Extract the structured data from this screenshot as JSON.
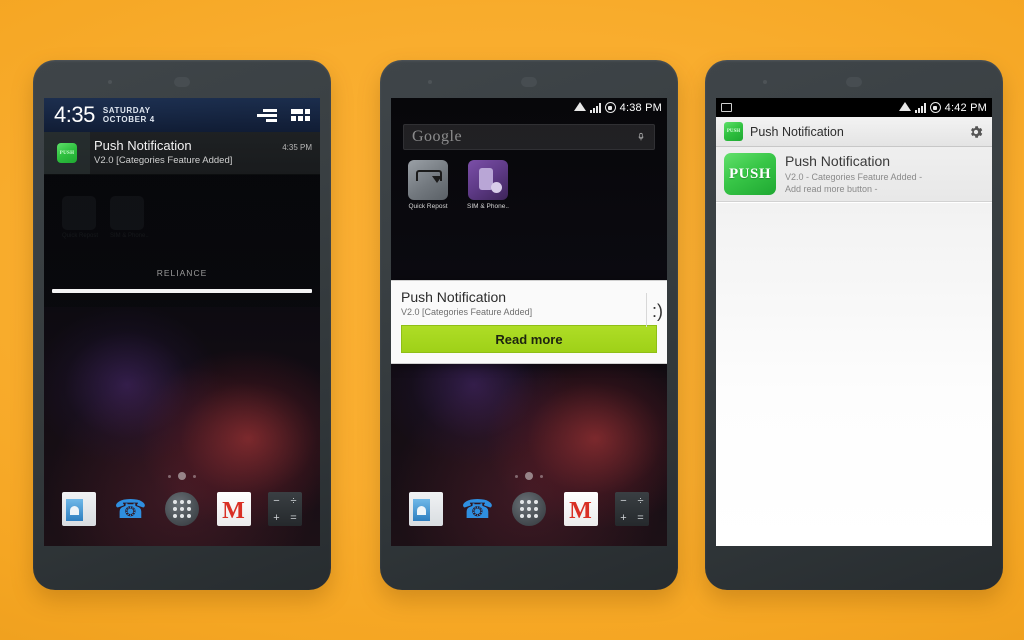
{
  "theme": {
    "background_accent": "#f5a623",
    "phone_body": "#353b3e",
    "brand_green": "#2fc03f",
    "button_green": "#a5d81f"
  },
  "phones": [
    {
      "id": "phone-notification-shade",
      "statusbar": {
        "clock": "4:35",
        "day": "SATURDAY",
        "date": "OCTOBER 4"
      },
      "actions": {
        "clear_icon": "clear-all-icon",
        "quicksettings_icon": "quick-settings-icon"
      },
      "notification": {
        "app_icon_label": "PUSH",
        "title": "Push Notification",
        "time": "4:35 PM",
        "subtitle": "V2.0 [Categories Feature Added]"
      },
      "carrier": "RELIANCE",
      "ghost_apps": [
        {
          "label": "Quick Repost"
        },
        {
          "label": "SIM & Phone.."
        }
      ],
      "dock": [
        {
          "name": "contacts",
          "label": "Contacts"
        },
        {
          "name": "phone",
          "label": "Phone"
        },
        {
          "name": "app-drawer",
          "label": "Apps"
        },
        {
          "name": "gmail",
          "label": "Gmail"
        },
        {
          "name": "calculator",
          "label": "Calculator"
        }
      ]
    },
    {
      "id": "phone-home-dialog",
      "statusbar": {
        "time": "4:38 PM",
        "icons": [
          "wifi-icon",
          "signal-icon",
          "volume-icon"
        ]
      },
      "search_widget": {
        "text": "Google",
        "mic_icon": "microphone-icon"
      },
      "apps": [
        {
          "label": "Quick Repost",
          "icon": "quick-repost-icon"
        },
        {
          "label": "SIM & Phone..",
          "icon": "sim-phone-icon"
        }
      ],
      "dialog": {
        "title": "Push Notification",
        "subtitle": "V2.0 [Categories Feature Added]",
        "smiley": ":)",
        "button_label": "Read more"
      },
      "dock": [
        {
          "name": "contacts",
          "label": "Contacts"
        },
        {
          "name": "phone",
          "label": "Phone"
        },
        {
          "name": "app-drawer",
          "label": "Apps"
        },
        {
          "name": "gmail",
          "label": "Gmail"
        },
        {
          "name": "calculator",
          "label": "Calculator"
        }
      ]
    },
    {
      "id": "phone-app-list",
      "statusbar": {
        "time": "4:42 PM",
        "icons": [
          "screenshot-icon",
          "wifi-icon",
          "signal-icon",
          "volume-icon"
        ]
      },
      "appbar": {
        "icon_label": "PUSH",
        "title": "Push Notification",
        "settings_icon": "gear-icon"
      },
      "list": [
        {
          "icon_label": "PUSH",
          "title": "Push Notification",
          "line1": "V2.0 - Categories Feature Added -",
          "line2": "Add read more button -"
        }
      ]
    }
  ]
}
